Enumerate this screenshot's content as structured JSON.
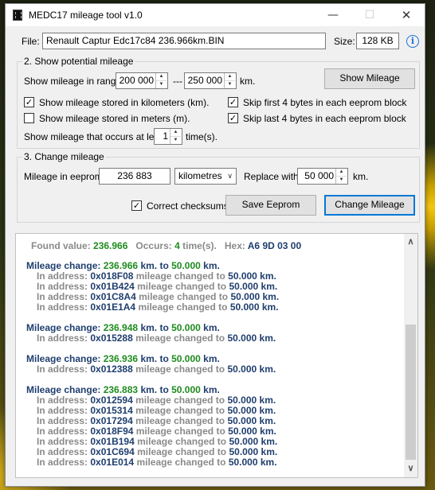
{
  "window": {
    "title": "MEDC17 mileage tool  v1.0"
  },
  "file": {
    "label": "File:",
    "value": "Renault Captur Edc17c84  236.966km.BIN",
    "size_label": "Size:",
    "size_value": "128 KB"
  },
  "show_section": {
    "title": "2. Show potential mileage",
    "range_label": "Show mileage in range:",
    "range_from": "200 000",
    "range_sep": "---",
    "range_to": "250 000",
    "range_unit": "km.",
    "show_button": "Show Mileage",
    "opt_km": {
      "label": "Show mileage stored in kilometers (km).",
      "checked": true
    },
    "opt_m": {
      "label": "Show mileage stored in meters (m).",
      "checked": false
    },
    "skip_first": {
      "label": "Skip first 4 bytes in each eeprom block",
      "checked": true
    },
    "skip_last": {
      "label": "Skip last 4 bytes in each eeprom block",
      "checked": true
    },
    "occurs_label": "Show mileage that occurs at least",
    "occurs_value": "1",
    "occurs_unit": "time(s)."
  },
  "change_section": {
    "title": "3. Change mileage",
    "eeprom_label": "Mileage in eeprom:",
    "eeprom_value": "236 883",
    "unit_selected": "kilometres",
    "replace_label": "Replace with",
    "replace_value": "50 000",
    "replace_unit": "km.",
    "checksum": {
      "label": "Correct checksums",
      "checked": true
    },
    "save_button": "Save Eeprom",
    "change_button": "Change Mileage"
  },
  "log": {
    "found_label": "Found value:",
    "found_value": "236.966",
    "occurs_label": "Occurs:",
    "occurs_value": "4",
    "occurs_unit": "time(s).",
    "hex_label": "Hex:",
    "hex_value": "A6 9D 03 00",
    "change_prefix": "Mileage change:",
    "km_to": "km. to",
    "km_dot": "km.",
    "addr_prefix": "In address:",
    "addr_mid": "mileage changed to",
    "groups": [
      {
        "from": "236.966",
        "to": "50.000",
        "addresses": [
          {
            "addr": "0x018F08",
            "val": "50.000"
          },
          {
            "addr": "0x01B424",
            "val": "50.000"
          },
          {
            "addr": "0x01C8A4",
            "val": "50.000"
          },
          {
            "addr": "0x01E1A4",
            "val": "50.000"
          }
        ]
      },
      {
        "from": "236.948",
        "to": "50.000",
        "addresses": [
          {
            "addr": "0x015288",
            "val": "50.000"
          }
        ]
      },
      {
        "from": "236.936",
        "to": "50.000",
        "addresses": [
          {
            "addr": "0x012388",
            "val": "50.000"
          }
        ]
      },
      {
        "from": "236.883",
        "to": "50.000",
        "addresses": [
          {
            "addr": "0x012594",
            "val": "50.000"
          },
          {
            "addr": "0x015314",
            "val": "50.000"
          },
          {
            "addr": "0x017294",
            "val": "50.000"
          },
          {
            "addr": "0x018F94",
            "val": "50.000"
          },
          {
            "addr": "0x01B194",
            "val": "50.000"
          },
          {
            "addr": "0x01C694",
            "val": "50.000"
          },
          {
            "addr": "0x01E014",
            "val": "50.000"
          }
        ]
      }
    ]
  }
}
